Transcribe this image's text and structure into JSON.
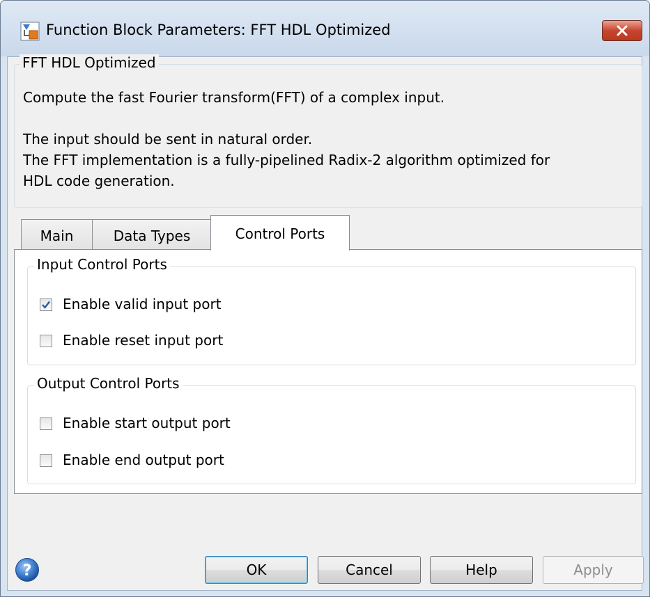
{
  "window": {
    "title": "Function Block Parameters: FFT HDL Optimized"
  },
  "block_group": {
    "legend": "FFT HDL Optimized",
    "description_lines": [
      "Compute the fast Fourier transform(FFT) of a complex input.",
      "",
      "The input should be sent in natural order.",
      "The FFT implementation is a fully-pipelined Radix-2 algorithm optimized for",
      "HDL code generation."
    ]
  },
  "tabs": [
    {
      "label": "Main",
      "active": false
    },
    {
      "label": "Data Types",
      "active": false
    },
    {
      "label": "Control Ports",
      "active": true
    }
  ],
  "input_group": {
    "legend": "Input Control Ports",
    "checkboxes": [
      {
        "label": "Enable valid input port",
        "checked": true
      },
      {
        "label": "Enable reset input port",
        "checked": false
      }
    ]
  },
  "output_group": {
    "legend": "Output Control Ports",
    "checkboxes": [
      {
        "label": "Enable start output port",
        "checked": false
      },
      {
        "label": "Enable end output port",
        "checked": false
      }
    ]
  },
  "buttons": {
    "ok": "OK",
    "cancel": "Cancel",
    "help": "Help",
    "apply": "Apply",
    "apply_enabled": false
  },
  "icons": {
    "app": "simulink-block-icon",
    "close": "close-icon",
    "help": "help-question-icon"
  }
}
